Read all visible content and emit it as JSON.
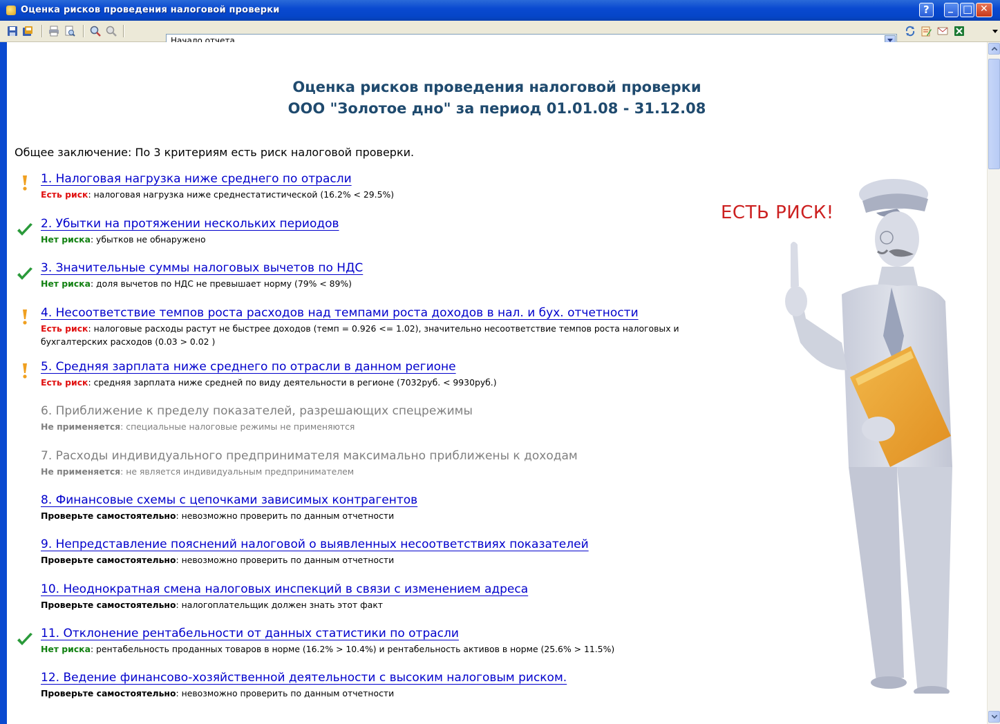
{
  "window": {
    "title": "Оценка рисков проведения налоговой проверки",
    "help_glyph": "?",
    "minimize_glyph": "_",
    "maximize_glyph": "□",
    "close_glyph": "✕"
  },
  "toolbar": {
    "address_value": "Начало отчета",
    "icons": [
      "save-icon",
      "save-as-icon",
      "print-icon",
      "print-preview-icon",
      "find-icon",
      "find-next-icon",
      "refresh-icon",
      "edit-icon",
      "email-icon",
      "excel-icon"
    ]
  },
  "report": {
    "title_line1": "Оценка рисков проведения налоговой проверки",
    "title_line2": "ООО \"Золотое дно\" за период 01.01.08 - 31.12.08",
    "conclusion": "Общее заключение: По 3 критериям есть риск налоговой проверки.",
    "badge": "ЕСТЬ РИСК!",
    "items": [
      {
        "title": "1. Налоговая нагрузка ниже среднего по отрасли",
        "status": "Есть риск",
        "text": ": налоговая нагрузка ниже среднестатистической (16.2% < 29.5%)"
      },
      {
        "title": "2. Убытки на протяжении нескольких периодов",
        "status": "Нет риска",
        "text": ": убытков не обнаружено"
      },
      {
        "title": "3. Значительные суммы налоговых вычетов по НДС",
        "status": "Нет риска",
        "text": ": доля вычетов по НДС не превышает норму (79% < 89%)"
      },
      {
        "title": "4. Несоответствие темпов роста расходов над темпами роста доходов в нал. и бух. отчетности",
        "status": "Есть риск",
        "text": ": налоговые расходы растут не быстрее доходов (темп = 0.926 <= 1.02), значительно несоответствие темпов роста налоговых и бухгалтерских расходов (0.03 > 0.02 )"
      },
      {
        "title": "5. Средняя зарплата ниже среднего по отрасли в данном регионе",
        "status": "Есть риск",
        "text": ": средняя зарплата ниже средней по виду деятельности в регионе (7032руб. < 9930руб.)"
      },
      {
        "title": "6. Приближение к пределу показателей, разрешающих спецрежимы",
        "status": "Не применяется",
        "text": ": специальные налоговые режимы не применяются"
      },
      {
        "title": "7. Расходы индивидуального предпринимателя максимально приближены к доходам",
        "status": "Не применяется",
        "text": ": не является индивидуальным предпринимателем"
      },
      {
        "title": "8. Финансовые схемы с цепочками зависимых контрагентов",
        "status": "Проверьте самостоятельно",
        "text": ": невозможно проверить по данным отчетности"
      },
      {
        "title": "9. Непредставление пояснений налоговой о выявленных несоответствиях показателей",
        "status": "Проверьте самостоятельно",
        "text": ": невозможно проверить по данным отчетности"
      },
      {
        "title": "10. Неоднократная смена налоговых инспекций в связи с изменением адреса",
        "status": "Проверьте самостоятельно",
        "text": ": налогоплательщик должен знать этот факт"
      },
      {
        "title": "11. Отклонение рентабельности от данных статистики по отрасли",
        "status": "Нет риска",
        "text": ": рентабельность проданных товаров в норме (16.2% > 10.4%) и рентабельность активов в норме (25.6% > 11.5%)"
      },
      {
        "title": "12. Ведение финансово-хозяйственной деятельности с высоким налоговым риском.",
        "status": "Проверьте самостоятельно",
        "text": ": невозможно проверить по данным отчетности"
      }
    ]
  },
  "colors": {
    "link": "#0000cc",
    "risk": "#e01010",
    "no_risk": "#108010",
    "na": "#808080",
    "title": "#1f4a6e",
    "badge": "#cc2020"
  }
}
